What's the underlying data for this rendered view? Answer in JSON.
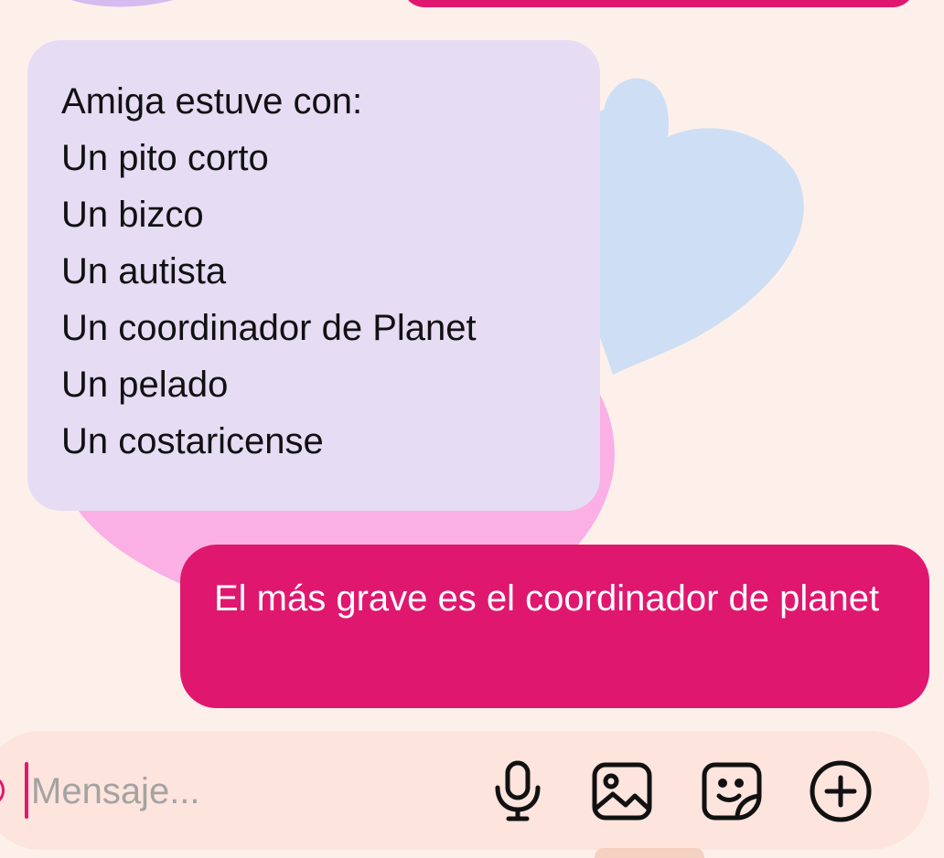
{
  "thread": {
    "received_message": {
      "lines": [
        "Amiga estuve con:",
        "Un pito corto",
        "Un bizco",
        "Un autista",
        "Un coordinador de Planet",
        "Un pelado",
        "Un costaricense"
      ]
    },
    "sent_message": {
      "text": "El más grave es el coordinador de planet"
    }
  },
  "composer": {
    "placeholder": "Mensaje...",
    "value": "",
    "icons": [
      "microphone-icon",
      "gallery-icon",
      "sticker-icon",
      "plus-circle-icon"
    ]
  },
  "colors": {
    "background": "#fdf0ea",
    "received_bubble": "#e6dcf4",
    "sent_bubble": "#e0176f",
    "composer": "#fde4dd"
  }
}
